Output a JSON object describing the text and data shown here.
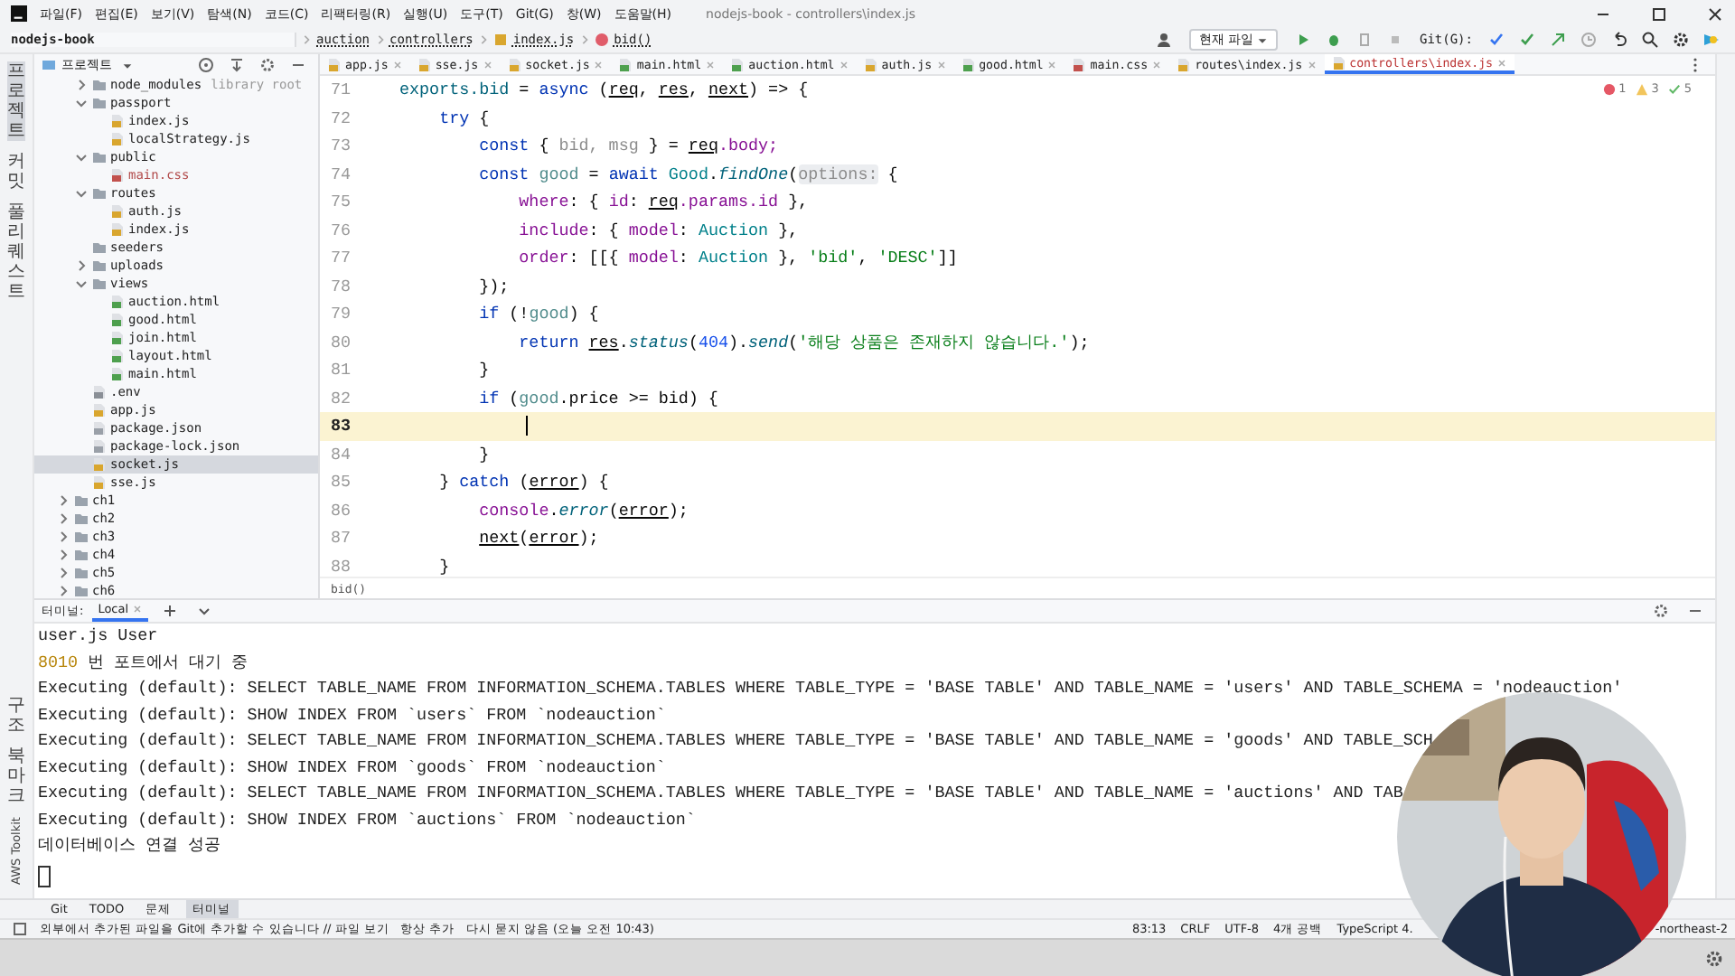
{
  "window": {
    "title": "nodejs-book - controllers\\index.js"
  },
  "menu": [
    "파일(F)",
    "편집(E)",
    "보기(V)",
    "탐색(N)",
    "코드(C)",
    "리팩터링(R)",
    "실행(U)",
    "도구(T)",
    "Git(G)",
    "창(W)",
    "도움말(H)"
  ],
  "breadcrumb": [
    {
      "label": "nodejs-book",
      "kind": "project"
    },
    {
      "label": "auction",
      "kind": "folder"
    },
    {
      "label": "controllers",
      "kind": "folder"
    },
    {
      "label": "index.js",
      "kind": "file"
    },
    {
      "label": "bid()",
      "kind": "function"
    }
  ],
  "toolbar": {
    "run_config": "현재 파일",
    "git_label": "Git(G):"
  },
  "project_panel": {
    "title": "프로젝트"
  },
  "side_strip": {
    "top": [
      {
        "label": "프로젝트",
        "selected": true
      },
      {
        "label": "커밋",
        "selected": false
      },
      {
        "label": "풀 리퀘스트",
        "selected": false
      }
    ],
    "bottom": [
      "구조",
      "북마크"
    ],
    "bottom_latin": "AWS Toolkit"
  },
  "tabs": [
    {
      "label": "app.js",
      "kind": "js",
      "selected": false
    },
    {
      "label": "sse.js",
      "kind": "js",
      "selected": false
    },
    {
      "label": "socket.js",
      "kind": "js",
      "selected": false
    },
    {
      "label": "main.html",
      "kind": "html",
      "selected": false
    },
    {
      "label": "auction.html",
      "kind": "html",
      "selected": false
    },
    {
      "label": "auth.js",
      "kind": "js",
      "selected": false
    },
    {
      "label": "good.html",
      "kind": "html",
      "selected": false
    },
    {
      "label": "main.css",
      "kind": "css",
      "selected": false
    },
    {
      "label": "routes\\index.js",
      "kind": "js",
      "selected": false
    },
    {
      "label": "controllers\\index.js",
      "kind": "js",
      "selected": true
    }
  ],
  "tree": {
    "items": [
      {
        "name": "node_modules",
        "kind": "folder",
        "expanded": false,
        "suffix": "library root",
        "selected": false
      },
      {
        "name": "passport",
        "kind": "folder",
        "expanded": true,
        "selected": false,
        "children": [
          {
            "name": "index.js",
            "kind": "js",
            "selected": false
          },
          {
            "name": "localStrategy.js",
            "kind": "js",
            "selected": false
          }
        ]
      },
      {
        "name": "public",
        "kind": "folder",
        "expanded": true,
        "selected": false,
        "children": [
          {
            "name": "main.css",
            "kind": "css",
            "selected": false
          }
        ]
      },
      {
        "name": "routes",
        "kind": "folder",
        "expanded": true,
        "selected": false,
        "children": [
          {
            "name": "auth.js",
            "kind": "js",
            "selected": false
          },
          {
            "name": "index.js",
            "kind": "js",
            "selected": false
          }
        ]
      },
      {
        "name": "seeders",
        "kind": "folder",
        "selected": false
      },
      {
        "name": "uploads",
        "kind": "folder",
        "expanded": false,
        "selected": false
      },
      {
        "name": "views",
        "kind": "folder",
        "expanded": true,
        "selected": false,
        "children": [
          {
            "name": "auction.html",
            "kind": "html",
            "selected": false
          },
          {
            "name": "good.html",
            "kind": "html",
            "selected": false
          },
          {
            "name": "join.html",
            "kind": "html",
            "selected": false
          },
          {
            "name": "layout.html",
            "kind": "html",
            "selected": false
          },
          {
            "name": "main.html",
            "kind": "html",
            "selected": false
          }
        ]
      },
      {
        "name": ".env",
        "kind": "env",
        "selected": false
      },
      {
        "name": "app.js",
        "kind": "js",
        "selected": false
      },
      {
        "name": "package.json",
        "kind": "json",
        "selected": false
      },
      {
        "name": "package-lock.json",
        "kind": "json",
        "selected": false
      },
      {
        "name": "socket.js",
        "kind": "js",
        "selected": true
      },
      {
        "name": "sse.js",
        "kind": "js",
        "selected": false
      }
    ],
    "outer_items": [
      {
        "name": "ch1",
        "kind": "folder",
        "expanded": false,
        "selected": false
      },
      {
        "name": "ch2",
        "kind": "folder",
        "expanded": false,
        "selected": false
      },
      {
        "name": "ch3",
        "kind": "folder",
        "expanded": false,
        "selected": false
      },
      {
        "name": "ch4",
        "kind": "folder",
        "expanded": false,
        "selected": false
      },
      {
        "name": "ch5",
        "kind": "folder",
        "expanded": false,
        "selected": false
      },
      {
        "name": "ch6",
        "kind": "folder",
        "expanded": false,
        "selected": false
      }
    ]
  },
  "inspections": {
    "errors": "1",
    "warnings": "3",
    "ok": "5"
  },
  "code": [
    {
      "number": "71",
      "current": false,
      "tokens": [
        {
          "t": "exports.bid",
          "kind": "fn"
        },
        {
          "t": " = ",
          "kind": "plain"
        },
        {
          "t": "async",
          "kind": "kw"
        },
        {
          "t": " (",
          "kind": "plain"
        },
        {
          "t": "req",
          "kind": "param"
        },
        {
          "t": ", ",
          "kind": "plain"
        },
        {
          "t": "res",
          "kind": "param"
        },
        {
          "t": ", ",
          "kind": "plain"
        },
        {
          "t": "next",
          "kind": "param"
        },
        {
          "t": ") => {",
          "kind": "plain"
        }
      ]
    },
    {
      "number": "72",
      "current": false,
      "tokens": [
        {
          "t": "    try",
          "kind": "kw"
        },
        {
          "t": " {",
          "kind": "plain"
        }
      ]
    },
    {
      "number": "73",
      "current": false,
      "tokens": [
        {
          "t": "        const",
          "kind": "kw"
        },
        {
          "t": " { ",
          "kind": "plain"
        },
        {
          "t": "bid, msg",
          "kind": "unused"
        },
        {
          "t": " } = ",
          "kind": "plain"
        },
        {
          "t": "req",
          "kind": "param"
        },
        {
          "t": ".body;",
          "kind": "prop"
        }
      ]
    },
    {
      "number": "74",
      "current": false,
      "tokens": [
        {
          "t": "        const",
          "kind": "kw"
        },
        {
          "t": " good",
          "kind": "local"
        },
        {
          "t": " = ",
          "kind": "plain"
        },
        {
          "t": "await",
          "kind": "kw"
        },
        {
          "t": " Good",
          "kind": "cls"
        },
        {
          "t": ".",
          "kind": "plain"
        },
        {
          "t": "findOne",
          "kind": "method"
        },
        {
          "t": "(",
          "kind": "plain"
        },
        {
          "t": "options:",
          "kind": "hint"
        },
        {
          "t": " {",
          "kind": "plain"
        }
      ]
    },
    {
      "number": "75",
      "current": false,
      "tokens": [
        {
          "t": "            where",
          "kind": "prop"
        },
        {
          "t": ": { ",
          "kind": "plain"
        },
        {
          "t": "id",
          "kind": "prop"
        },
        {
          "t": ": ",
          "kind": "plain"
        },
        {
          "t": "req",
          "kind": "param"
        },
        {
          "t": ".params.id",
          "kind": "prop"
        },
        {
          "t": " },",
          "kind": "plain"
        }
      ]
    },
    {
      "number": "76",
      "current": false,
      "tokens": [
        {
          "t": "            include",
          "kind": "prop"
        },
        {
          "t": ": { ",
          "kind": "plain"
        },
        {
          "t": "model",
          "kind": "prop"
        },
        {
          "t": ": ",
          "kind": "plain"
        },
        {
          "t": "Auction",
          "kind": "cls"
        },
        {
          "t": " },",
          "kind": "plain"
        }
      ]
    },
    {
      "number": "77",
      "current": false,
      "tokens": [
        {
          "t": "            order",
          "kind": "prop"
        },
        {
          "t": ": [[{ ",
          "kind": "plain"
        },
        {
          "t": "model",
          "kind": "prop"
        },
        {
          "t": ": ",
          "kind": "plain"
        },
        {
          "t": "Auction",
          "kind": "cls"
        },
        {
          "t": " }, ",
          "kind": "plain"
        },
        {
          "t": "'bid'",
          "kind": "str"
        },
        {
          "t": ", ",
          "kind": "plain"
        },
        {
          "t": "'DESC'",
          "kind": "str"
        },
        {
          "t": "]]",
          "kind": "plain"
        }
      ]
    },
    {
      "number": "78",
      "current": false,
      "tokens": [
        {
          "t": "        });",
          "kind": "plain"
        }
      ]
    },
    {
      "number": "79",
      "current": false,
      "tokens": [
        {
          "t": "        if",
          "kind": "kw"
        },
        {
          "t": " (!",
          "kind": "plain"
        },
        {
          "t": "good",
          "kind": "local"
        },
        {
          "t": ") {",
          "kind": "plain"
        }
      ]
    },
    {
      "number": "80",
      "current": false,
      "tokens": [
        {
          "t": "            return",
          "kind": "kw"
        },
        {
          "t": " res",
          "kind": "param"
        },
        {
          "t": ".",
          "kind": "plain"
        },
        {
          "t": "status",
          "kind": "method"
        },
        {
          "t": "(",
          "kind": "plain"
        },
        {
          "t": "404",
          "kind": "num"
        },
        {
          "t": ").",
          "kind": "plain"
        },
        {
          "t": "send",
          "kind": "method"
        },
        {
          "t": "(",
          "kind": "plain"
        },
        {
          "t": "'해당 상품은 존재하지 않습니다.'",
          "kind": "str"
        },
        {
          "t": ");",
          "kind": "plain"
        }
      ]
    },
    {
      "number": "81",
      "current": false,
      "tokens": [
        {
          "t": "        }",
          "kind": "plain"
        }
      ]
    },
    {
      "number": "82",
      "current": false,
      "tokens": [
        {
          "t": "        if",
          "kind": "kw"
        },
        {
          "t": " (",
          "kind": "plain"
        },
        {
          "t": "good",
          "kind": "local"
        },
        {
          "t": ".price >= bid) {",
          "kind": "plain"
        }
      ]
    },
    {
      "number": "83",
      "current": true
    },
    {
      "number": "84",
      "current": false,
      "tokens": [
        {
          "t": "        }",
          "kind": "plain"
        }
      ]
    },
    {
      "number": "85",
      "current": false,
      "tokens": [
        {
          "t": "    } ",
          "kind": "plain"
        },
        {
          "t": "catch",
          "kind": "kw"
        },
        {
          "t": " (",
          "kind": "plain"
        },
        {
          "t": "error",
          "kind": "param"
        },
        {
          "t": ") {",
          "kind": "plain"
        }
      ]
    },
    {
      "number": "86",
      "current": false,
      "tokens": [
        {
          "t": "        console",
          "kind": "prop"
        },
        {
          "t": ".",
          "kind": "plain"
        },
        {
          "t": "error",
          "kind": "method"
        },
        {
          "t": "(",
          "kind": "plain"
        },
        {
          "t": "error",
          "kind": "param"
        },
        {
          "t": ");",
          "kind": "plain"
        }
      ]
    },
    {
      "number": "87",
      "current": false,
      "tokens": [
        {
          "t": "        next",
          "kind": "param"
        },
        {
          "t": "(",
          "kind": "plain"
        },
        {
          "t": "error",
          "kind": "param"
        },
        {
          "t": ");",
          "kind": "plain"
        }
      ]
    },
    {
      "number": "88",
      "current": false,
      "tokens": [
        {
          "t": "    }",
          "kind": "plain"
        }
      ]
    }
  ],
  "editor_breadcrumb": "bid()",
  "terminal": {
    "title": "터미널:",
    "tab": "Local",
    "lines": [
      {
        "text": "user.js User"
      },
      {
        "lead": "8010",
        "text": " 번 포트에서 대기 중"
      },
      {
        "text": "Executing (default): SELECT TABLE_NAME FROM INFORMATION_SCHEMA.TABLES WHERE TABLE_TYPE = 'BASE TABLE' AND TABLE_NAME = 'users' AND TABLE_SCHEMA = 'nodeauction'"
      },
      {
        "text": "Executing (default): SHOW INDEX FROM `users` FROM `nodeauction`"
      },
      {
        "text": "Executing (default): SELECT TABLE_NAME FROM INFORMATION_SCHEMA.TABLES WHERE TABLE_TYPE = 'BASE TABLE' AND TABLE_NAME = 'goods' AND TABLE_SCH"
      },
      {
        "text": "Executing (default): SHOW INDEX FROM `goods` FROM `nodeauction`"
      },
      {
        "text": "Executing (default): SELECT TABLE_NAME FROM INFORMATION_SCHEMA.TABLES WHERE TABLE_TYPE = 'BASE TABLE' AND TABLE_NAME = 'auctions' AND TAB"
      },
      {
        "text": "Executing (default): SHOW INDEX FROM `auctions` FROM `nodeauction`"
      },
      {
        "text": "데이터베이스 연결 성공"
      }
    ]
  },
  "tool_tabs": [
    {
      "label": "Git",
      "selected": false
    },
    {
      "label": "TODO",
      "selected": false
    },
    {
      "label": "문제",
      "selected": false
    },
    {
      "label": "터미널",
      "selected": true
    }
  ],
  "status_bar": {
    "message": "외부에서 추가된 파일을 Git에 추가할 수 있습니다 // 파일 보기   항상 추가   다시 묻지 않음 (오늘 오전 10:43)",
    "items": [
      "83:13",
      "CRLF",
      "UTF-8",
      "4개 공백",
      "TypeScript 4."
    ],
    "tail": "-northeast-2"
  }
}
